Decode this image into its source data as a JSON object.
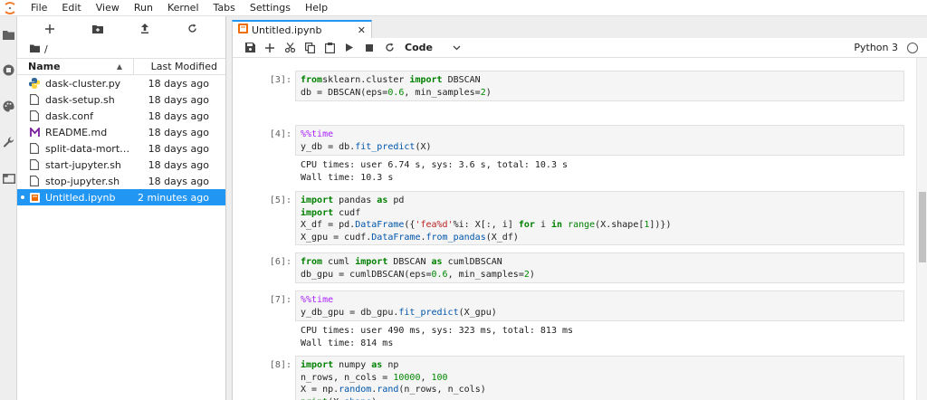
{
  "menubar": {
    "items": [
      "File",
      "Edit",
      "View",
      "Run",
      "Kernel",
      "Tabs",
      "Settings",
      "Help"
    ]
  },
  "sidebar_icons": [
    "folder-icon",
    "running-icon",
    "palette-icon",
    "wrench-icon",
    "tabs-icon"
  ],
  "filebrowser": {
    "toolbar": [
      "new-launcher-icon",
      "new-folder-icon",
      "upload-icon",
      "refresh-icon"
    ],
    "path": "/",
    "columns": {
      "name": "Name",
      "modified": "Last Modified"
    },
    "files": [
      {
        "name": "dask-cluster.py",
        "modified": "18 days ago",
        "icon": "python-file-icon",
        "selected": false
      },
      {
        "name": "dask-setup.sh",
        "modified": "18 days ago",
        "icon": "file-icon",
        "selected": false
      },
      {
        "name": "dask.conf",
        "modified": "18 days ago",
        "icon": "file-icon",
        "selected": false
      },
      {
        "name": "README.md",
        "modified": "18 days ago",
        "icon": "markdown-icon",
        "selected": false
      },
      {
        "name": "split-data-mortgage.sh",
        "modified": "18 days ago",
        "icon": "file-icon",
        "selected": false
      },
      {
        "name": "start-jupyter.sh",
        "modified": "18 days ago",
        "icon": "file-icon",
        "selected": false
      },
      {
        "name": "stop-jupyter.sh",
        "modified": "18 days ago",
        "icon": "file-icon",
        "selected": false
      },
      {
        "name": "Untitled.ipynb",
        "modified": "2 minutes ago",
        "icon": "notebook-icon",
        "selected": true
      }
    ]
  },
  "tab": {
    "title": "Untitled.ipynb"
  },
  "notebook_toolbar": {
    "cell_type": "Code",
    "kernel": "Python 3"
  },
  "cells": [
    {
      "prompt": "[3]:",
      "code": [
        [
          [
            "kw",
            "from"
          ],
          [
            "",
            "sklearn.cluster "
          ],
          [
            "kw",
            "import"
          ],
          [
            "",
            " DBSCAN"
          ]
        ],
        [
          [
            "",
            "db = DBSCAN(eps="
          ],
          [
            "num",
            "0.6"
          ],
          [
            "",
            ", min_samples="
          ],
          [
            "num",
            "2"
          ],
          [
            "",
            ")"
          ]
        ]
      ],
      "output": []
    },
    {
      "prompt": "[4]:",
      "code": [
        [
          [
            "magic",
            "%%time"
          ]
        ],
        [
          [
            "",
            "y_db = db."
          ],
          [
            "fn",
            "fit_predict"
          ],
          [
            "",
            "(X)"
          ]
        ]
      ],
      "output": [
        "CPU times: user 6.74 s, sys: 3.6 s, total: 10.3 s",
        "Wall time: 10.3 s"
      ]
    },
    {
      "prompt": "[5]:",
      "code": [
        [
          [
            "kw",
            "import"
          ],
          [
            "",
            " pandas "
          ],
          [
            "kw",
            "as"
          ],
          [
            "",
            " pd"
          ]
        ],
        [
          [
            "kw",
            "import"
          ],
          [
            "",
            " cudf"
          ]
        ],
        [
          [
            "",
            "X_df = pd."
          ],
          [
            "fn",
            "DataFrame"
          ],
          [
            "",
            "({"
          ],
          [
            "str",
            "'fea%d'"
          ],
          [
            "",
            "%i: X[:, i] "
          ],
          [
            "kw",
            "for"
          ],
          [
            "",
            " i "
          ],
          [
            "kw",
            "in"
          ],
          [
            "",
            " "
          ],
          [
            "bi",
            "range"
          ],
          [
            "",
            "(X.shape["
          ],
          [
            "num",
            "1"
          ],
          [
            "",
            "])})"
          ]
        ],
        [
          [
            "",
            "X_gpu = cudf."
          ],
          [
            "fn",
            "DataFrame"
          ],
          [
            "",
            "."
          ],
          [
            "fn",
            "from_pandas"
          ],
          [
            "",
            "(X_df)"
          ]
        ]
      ],
      "output": []
    },
    {
      "prompt": "[6]:",
      "code": [
        [
          [
            "kw",
            "from"
          ],
          [
            "",
            " cuml "
          ],
          [
            "kw",
            "import"
          ],
          [
            "",
            " DBSCAN "
          ],
          [
            "kw",
            "as"
          ],
          [
            "",
            " cumlDBSCAN"
          ]
        ],
        [
          [
            "",
            "db_gpu = cumlDBSCAN(eps="
          ],
          [
            "num",
            "0.6"
          ],
          [
            "",
            ", min_samples="
          ],
          [
            "num",
            "2"
          ],
          [
            "",
            ")"
          ]
        ]
      ],
      "output": []
    },
    {
      "prompt": "[7]:",
      "code": [
        [
          [
            "magic",
            "%%time"
          ]
        ],
        [
          [
            "",
            "y_db_gpu = db_gpu."
          ],
          [
            "fn",
            "fit_predict"
          ],
          [
            "",
            "(X_gpu)"
          ]
        ]
      ],
      "output": [
        "CPU times: user 490 ms, sys: 323 ms, total: 813 ms",
        "Wall time: 814 ms"
      ]
    },
    {
      "prompt": "[8]:",
      "code": [
        [
          [
            "kw",
            "import"
          ],
          [
            "",
            " numpy "
          ],
          [
            "kw",
            "as"
          ],
          [
            "",
            " np"
          ]
        ],
        [
          [
            "",
            "n_rows, n_cols = "
          ],
          [
            "num",
            "10000"
          ],
          [
            "",
            ", "
          ],
          [
            "num",
            "100"
          ]
        ],
        [
          [
            "",
            "X = np."
          ],
          [
            "fn",
            "random"
          ],
          [
            "",
            "."
          ],
          [
            "fn",
            "rand"
          ],
          [
            "",
            "(n_rows, n_cols)"
          ]
        ],
        [
          [
            "bi",
            "print"
          ],
          [
            "",
            "(X."
          ],
          [
            "fn",
            "shape"
          ],
          [
            "",
            ")"
          ]
        ]
      ],
      "output": []
    }
  ]
}
